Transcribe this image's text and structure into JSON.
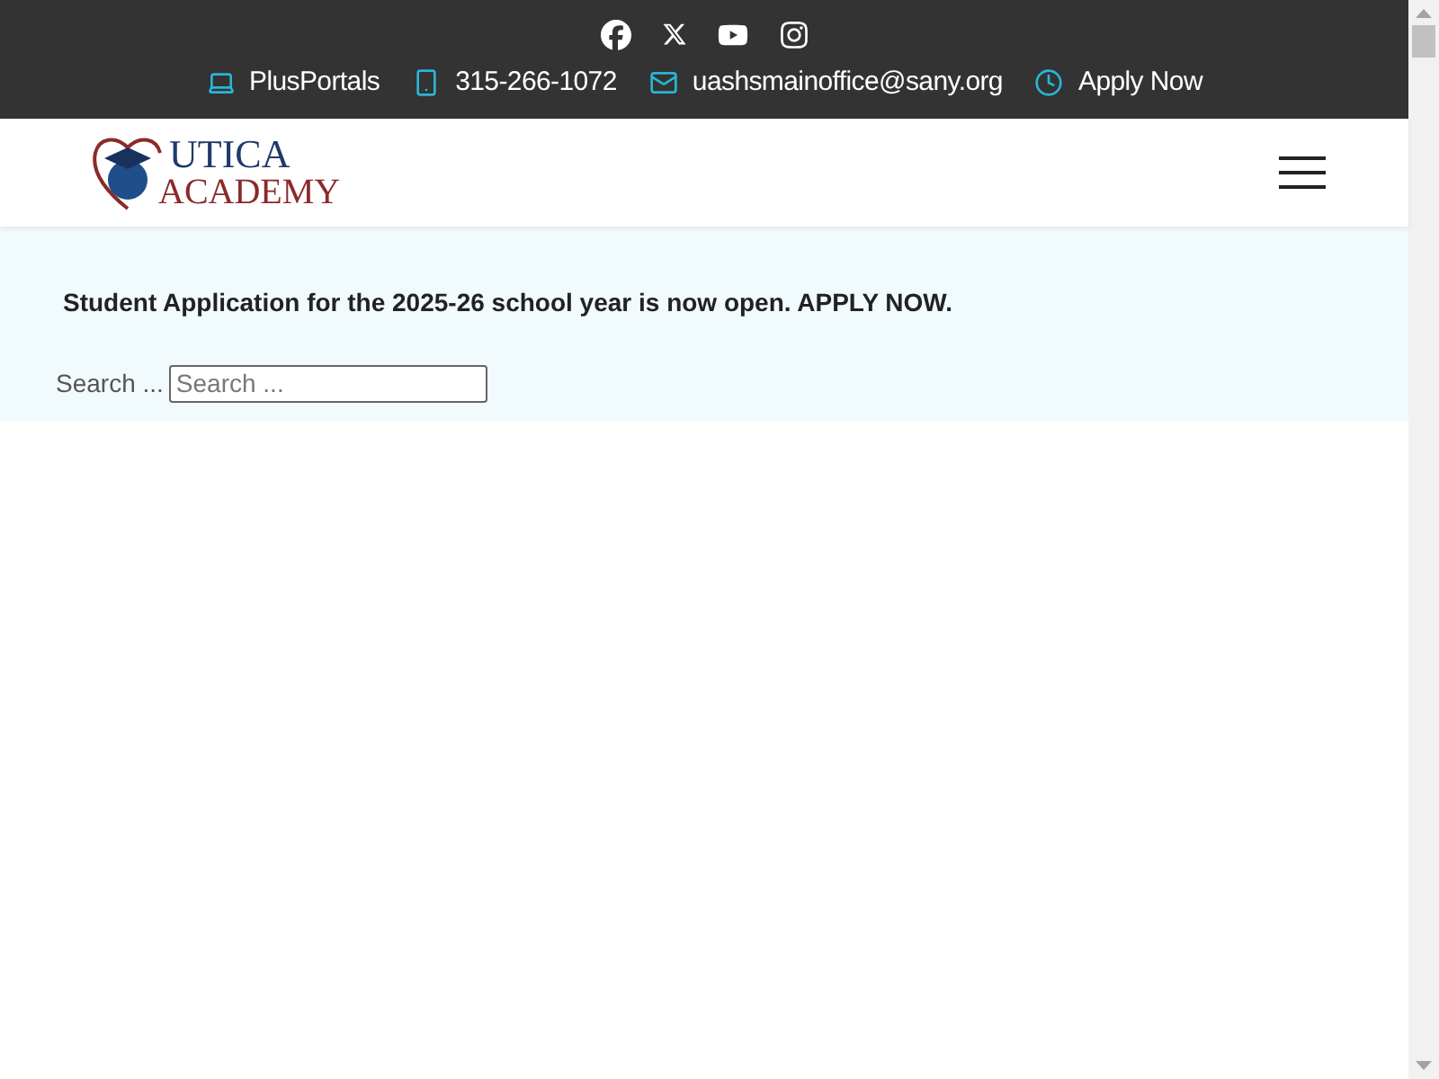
{
  "top_bar": {
    "social_links": [
      {
        "kind": "facebook"
      },
      {
        "kind": "x"
      },
      {
        "kind": "youtube"
      },
      {
        "kind": "instagram"
      }
    ],
    "contacts": [
      {
        "kind": "laptop",
        "label": "PlusPortals"
      },
      {
        "kind": "phone",
        "label": "315-266-1072"
      },
      {
        "kind": "mail",
        "label": "uashsmainoffice@sany.org"
      },
      {
        "kind": "clock",
        "label": "Apply Now"
      }
    ]
  },
  "header": {
    "logo": {
      "line_1": "UTICA",
      "line_2": "ACADEMY"
    }
  },
  "announcement": "Student Application for the 2025-26 school year is now open. APPLY NOW.",
  "search": {
    "label": "Search ...",
    "placeholder": "Search ..."
  }
}
